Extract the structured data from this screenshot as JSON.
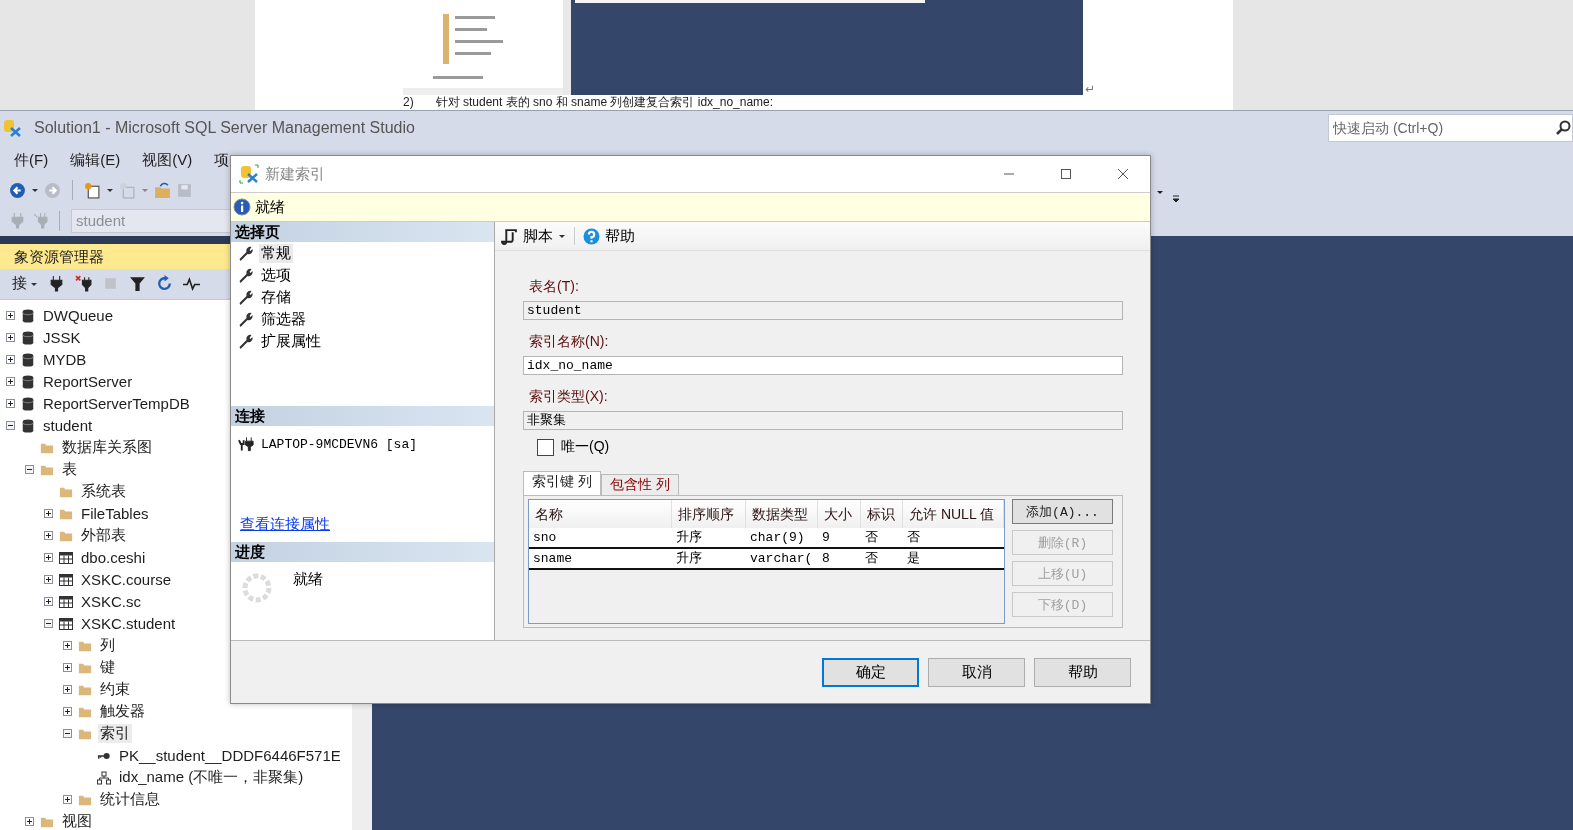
{
  "document": {
    "number": "2)",
    "text": "针对 student 表的 sno 和 sname 列创建复合索引 idx_no_name:",
    "mark": "↵"
  },
  "window": {
    "title": "Solution1 - Microsoft SQL Server Management Studio"
  },
  "quick_launch": {
    "placeholder": "快速启动 (Ctrl+Q)"
  },
  "menu": [
    "件(F)",
    "编辑(E)",
    "视图(V)",
    "项"
  ],
  "toolbar": {
    "database": "student"
  },
  "object_explorer": {
    "title": "象资源管理器",
    "connect": "接",
    "tree": [
      {
        "label": "DWQueue",
        "kind": "database",
        "expanded": false,
        "selected": false
      },
      {
        "label": "JSSK",
        "kind": "database",
        "expanded": false,
        "selected": false
      },
      {
        "label": "MYDB",
        "kind": "database",
        "expanded": false,
        "selected": false
      },
      {
        "label": "ReportServer",
        "kind": "database",
        "expanded": false,
        "selected": false
      },
      {
        "label": "ReportServerTempDB",
        "kind": "database",
        "expanded": false,
        "selected": false
      },
      {
        "label": "student",
        "kind": "database",
        "expanded": true,
        "selected": false,
        "children": [
          {
            "label": "数据库关系图",
            "kind": "folder",
            "selected": false
          },
          {
            "label": "表",
            "kind": "folder",
            "expanded": true,
            "selected": false,
            "children": [
              {
                "label": "系统表",
                "kind": "folder",
                "selected": false
              },
              {
                "label": "FileTables",
                "kind": "folder",
                "expanded": false,
                "selected": false
              },
              {
                "label": "外部表",
                "kind": "folder",
                "expanded": false,
                "selected": false
              },
              {
                "label": "dbo.ceshi",
                "kind": "table",
                "expanded": false,
                "selected": false
              },
              {
                "label": "XSKC.course",
                "kind": "table",
                "expanded": false,
                "selected": false
              },
              {
                "label": "XSKC.sc",
                "kind": "table",
                "expanded": false,
                "selected": false
              },
              {
                "label": "XSKC.student",
                "kind": "table",
                "expanded": true,
                "selected": false,
                "children": [
                  {
                    "label": "列",
                    "kind": "folder",
                    "expanded": false,
                    "selected": false
                  },
                  {
                    "label": "键",
                    "kind": "folder",
                    "expanded": false,
                    "selected": false
                  },
                  {
                    "label": "约束",
                    "kind": "folder",
                    "expanded": false,
                    "selected": false
                  },
                  {
                    "label": "触发器",
                    "kind": "folder",
                    "expanded": false,
                    "selected": false
                  },
                  {
                    "label": "索引",
                    "kind": "folder",
                    "expanded": true,
                    "selected": true,
                    "children": [
                      {
                        "label": "PK__student__DDDF6446F571E",
                        "kind": "key",
                        "selected": false
                      },
                      {
                        "label": "idx_name (不唯一，非聚集)",
                        "kind": "index",
                        "selected": false
                      }
                    ]
                  },
                  {
                    "label": "统计信息",
                    "kind": "folder",
                    "expanded": false,
                    "selected": false
                  }
                ]
              }
            ]
          },
          {
            "label": "视图",
            "kind": "folder",
            "expanded": false,
            "selected": false
          }
        ]
      }
    ]
  },
  "dialog": {
    "title": "新建索引",
    "status": "就绪",
    "select_page": {
      "heading": "选择页",
      "pages": [
        {
          "label": "常规",
          "selected": true
        },
        {
          "label": "选项",
          "selected": false
        },
        {
          "label": "存储",
          "selected": false
        },
        {
          "label": "筛选器",
          "selected": false
        },
        {
          "label": "扩展属性",
          "selected": false
        }
      ]
    },
    "connection": {
      "heading": "连接",
      "server": "LAPTOP-9MCDEVN6 [sa]",
      "link": "查看连接属性"
    },
    "progress": {
      "heading": "进度",
      "status": "就绪"
    },
    "toolbar": {
      "script": "脚本",
      "help": "帮助"
    },
    "fields": [
      {
        "label": "表名(T):",
        "value": "student",
        "disabled": true
      },
      {
        "label": "索引名称(N):",
        "value": "idx_no_name",
        "disabled": false
      },
      {
        "label": "索引类型(X):",
        "value": "非聚集",
        "disabled": true
      }
    ],
    "unique": {
      "label": "唯一(Q)",
      "checked": false
    },
    "tabs": [
      {
        "label": "索引键 列",
        "selected": true
      },
      {
        "label": "包含性 列",
        "selected": false
      }
    ],
    "grid": {
      "columns": [
        "名称",
        "排序顺序",
        "数据类型",
        "大小",
        "标识",
        "允许 NULL 值"
      ],
      "rows": [
        [
          "sno",
          "升序",
          "char(9)",
          "9",
          "否",
          "否"
        ],
        [
          "sname",
          "升序",
          "varchar(",
          "8",
          "否",
          "是"
        ]
      ]
    },
    "side_buttons": [
      {
        "label": "添加(A)...",
        "disabled": false
      },
      {
        "label": "删除(R)",
        "disabled": true
      },
      {
        "label": "上移(U)",
        "disabled": true
      },
      {
        "label": "下移(D)",
        "disabled": true
      }
    ],
    "buttons": [
      {
        "label": "确定",
        "default": true
      },
      {
        "label": "取消",
        "default": false
      },
      {
        "label": "帮助",
        "default": false
      }
    ]
  }
}
